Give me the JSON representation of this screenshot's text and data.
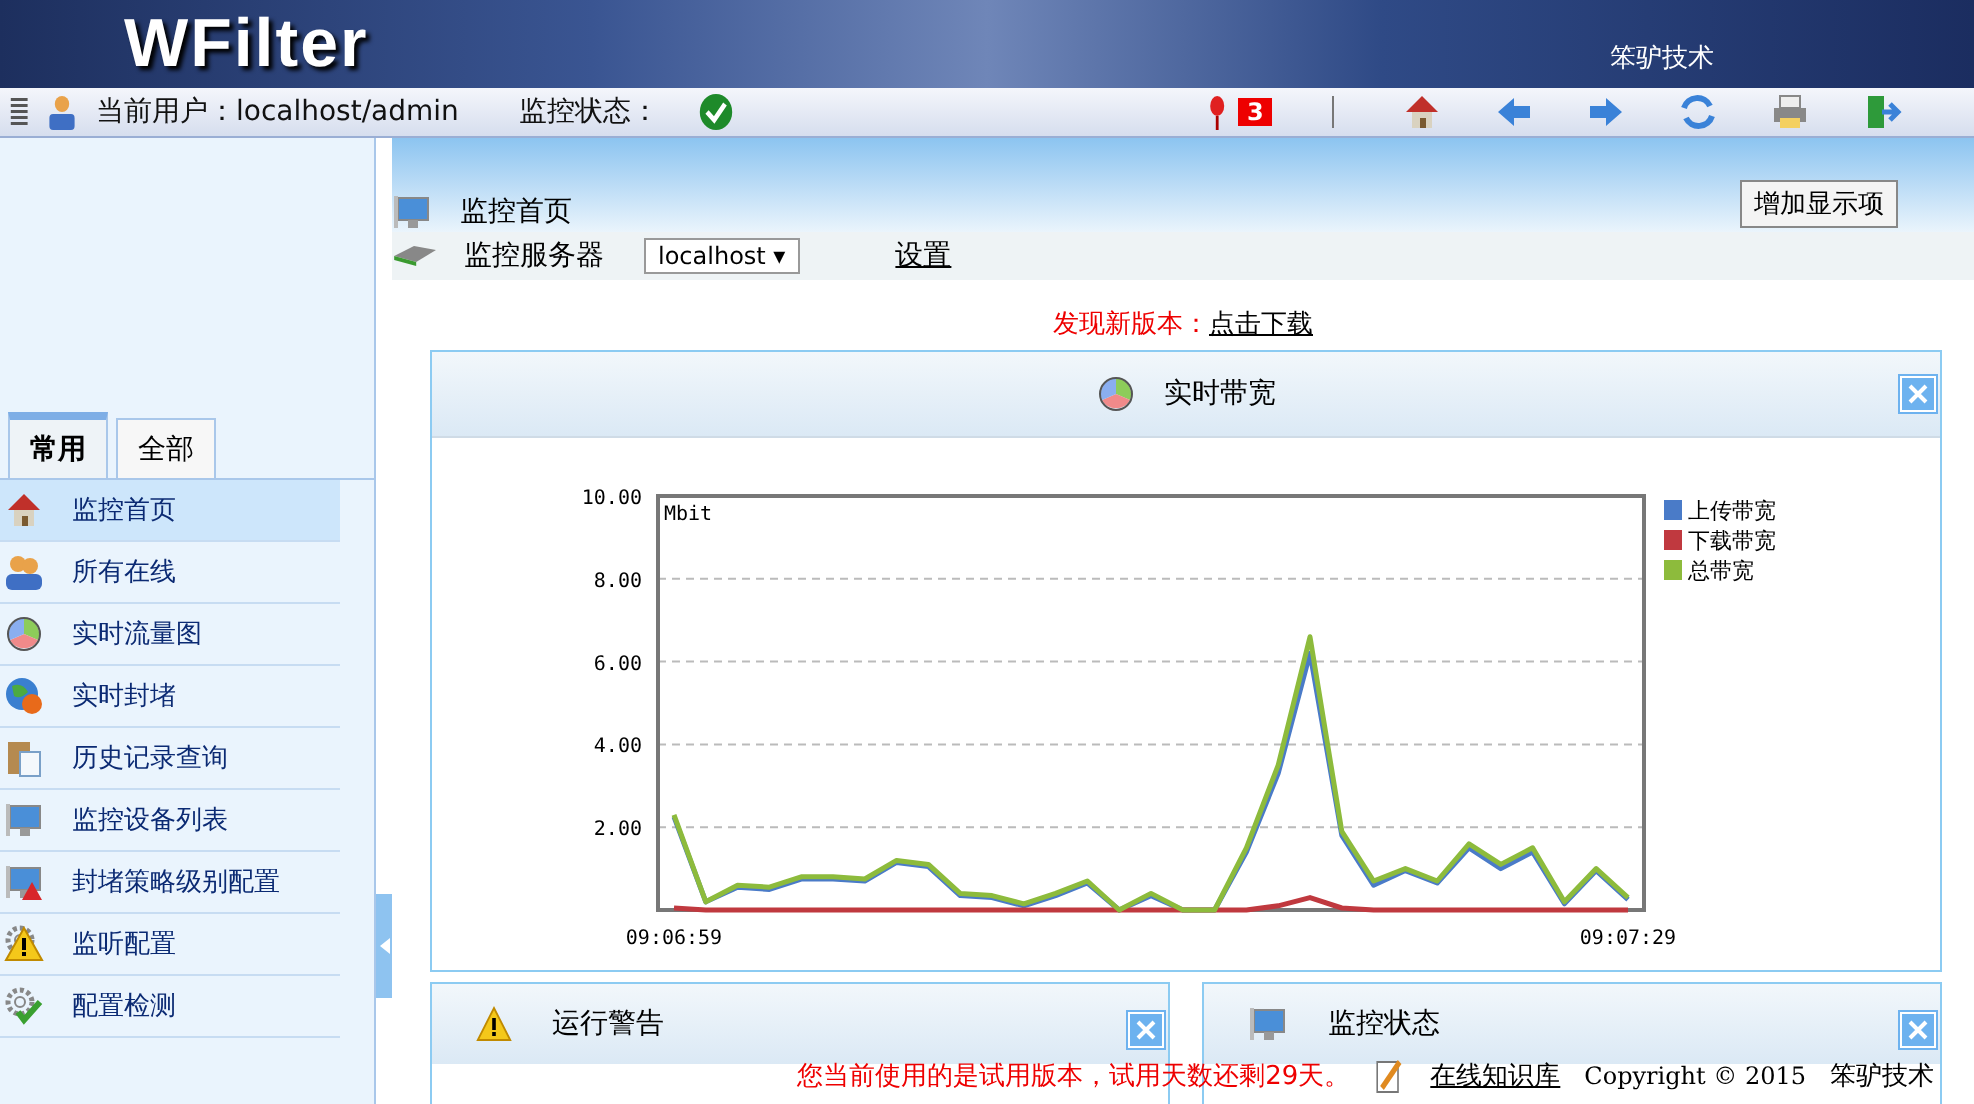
{
  "banner": {
    "logo": "WFilter",
    "company": "笨驴技术"
  },
  "toolbar": {
    "user_label": "当前用户：",
    "user": "localhost/admin",
    "status_label": "监控状态：",
    "alert_count": "3"
  },
  "sidebar": {
    "tabs": [
      {
        "label": "常用",
        "selected": true
      },
      {
        "label": "全部",
        "selected": false
      }
    ],
    "items": [
      {
        "label": "监控首页",
        "selected": true
      },
      {
        "label": "所有在线",
        "selected": false
      },
      {
        "label": "实时流量图",
        "selected": false
      },
      {
        "label": "实时封堵",
        "selected": false
      },
      {
        "label": "历史记录查询",
        "selected": false
      },
      {
        "label": "监控设备列表",
        "selected": false
      },
      {
        "label": "封堵策略级别配置",
        "selected": false
      },
      {
        "label": "监听配置",
        "selected": false
      },
      {
        "label": "配置检测",
        "selected": false
      }
    ]
  },
  "page": {
    "title": "监控首页",
    "add_button": "增加显示项",
    "server_label": "监控服务器",
    "server_value": "localhost ▾",
    "settings_link": "设置",
    "notice": "发现新版本：",
    "notice_link": "点击下载"
  },
  "bandwidth_panel": {
    "title": "实时带宽",
    "chart_data": {
      "type": "line",
      "ylabel": "Mbit",
      "ylim": [
        0,
        10
      ],
      "yticks": [
        {
          "value": 2,
          "label": "2.00"
        },
        {
          "value": 4,
          "label": "4.00"
        },
        {
          "value": 6,
          "label": "6.00"
        },
        {
          "value": 8,
          "label": "8.00"
        },
        {
          "value": 10,
          "label": "10.00"
        }
      ],
      "grid": true,
      "legend": "right",
      "categories": [
        "09:06:59",
        null,
        null,
        null,
        null,
        null,
        null,
        null,
        null,
        null,
        null,
        null,
        null,
        null,
        null,
        null,
        null,
        null,
        null,
        null,
        null,
        null,
        null,
        null,
        null,
        null,
        null,
        null,
        null,
        null,
        "09:07:29"
      ],
      "series": [
        {
          "name": "上传带宽",
          "color": "#4a7bc8",
          "values": [
            2.25,
            0.2,
            0.55,
            0.5,
            0.75,
            0.75,
            0.7,
            1.15,
            1.05,
            0.35,
            0.3,
            0.1,
            0.35,
            0.65,
            0.0,
            0.35,
            0.0,
            0.0,
            1.4,
            3.3,
            6.2,
            1.8,
            0.6,
            0.95,
            0.65,
            1.5,
            1.0,
            1.4,
            0.15,
            0.95,
            0.25
          ]
        },
        {
          "name": "下载带宽",
          "color": "#c0393f",
          "values": [
            0.05,
            0.0,
            0.0,
            0.0,
            0.0,
            0.0,
            0.0,
            0.0,
            0.0,
            0.0,
            0.0,
            0.0,
            0.0,
            0.0,
            0.0,
            0.0,
            0.0,
            0.0,
            0.0,
            0.1,
            0.3,
            0.05,
            0.0,
            0.0,
            0.0,
            0.0,
            0.0,
            0.0,
            0.0,
            0.0,
            0.0
          ]
        },
        {
          "name": "总带宽",
          "color": "#8dbb3c",
          "values": [
            2.3,
            0.2,
            0.6,
            0.55,
            0.8,
            0.8,
            0.75,
            1.2,
            1.1,
            0.4,
            0.35,
            0.15,
            0.4,
            0.7,
            0.0,
            0.4,
            0.0,
            0.0,
            1.5,
            3.5,
            6.6,
            1.9,
            0.7,
            1.0,
            0.7,
            1.6,
            1.1,
            1.5,
            0.2,
            1.0,
            0.3
          ]
        }
      ]
    }
  },
  "bottom_panels": [
    {
      "title": "运行警告"
    },
    {
      "title": "监控状态"
    }
  ],
  "footer": {
    "trial_notice": "您当前使用的是试用版本，试用天数还剩29天。",
    "kb_link": "在线知识库",
    "copyright": "Copyright © 2015",
    "company": "笨驴技术"
  }
}
